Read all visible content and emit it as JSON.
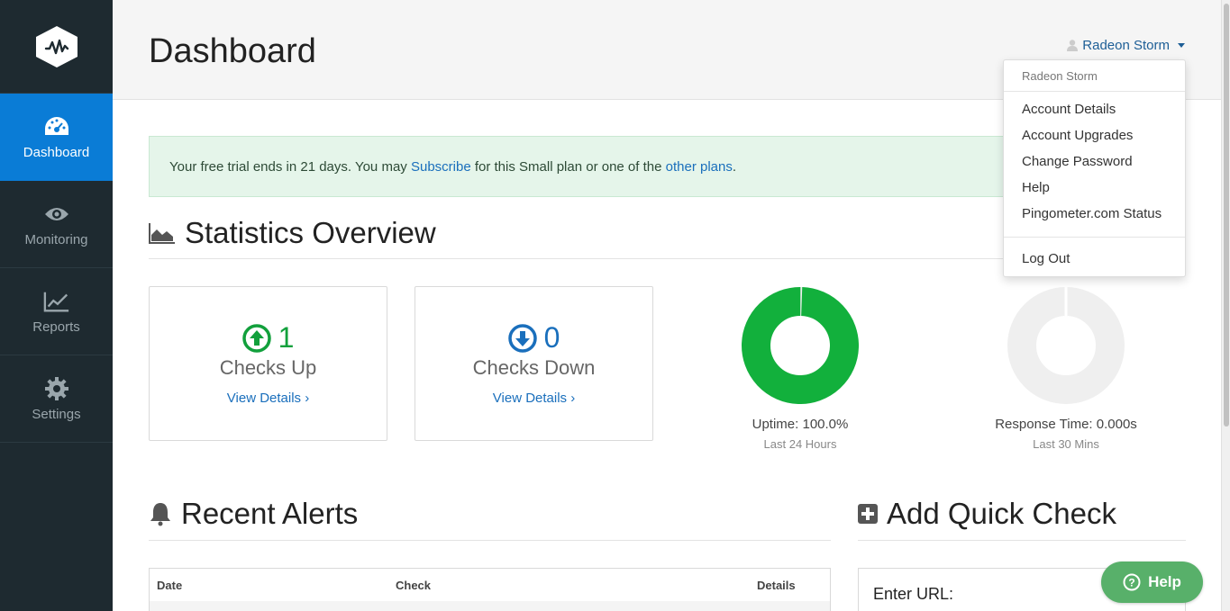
{
  "sidebar": {
    "items": [
      {
        "label": "Dashboard",
        "icon": "dashboard-gauge-icon",
        "active": true
      },
      {
        "label": "Monitoring",
        "icon": "eye-icon",
        "active": false
      },
      {
        "label": "Reports",
        "icon": "line-chart-icon",
        "active": false
      },
      {
        "label": "Settings",
        "icon": "gear-icon",
        "active": false
      }
    ]
  },
  "header": {
    "title": "Dashboard",
    "user_name": "Radeon Storm"
  },
  "trial_notice": {
    "prefix": "Your free trial ends in 21 days. You may ",
    "subscribe_link": "Subscribe",
    "middle": " for this Small plan or one of the ",
    "plans_link": "other plans",
    "suffix": "."
  },
  "statistics": {
    "title": "Statistics Overview",
    "checks_up": {
      "value": "1",
      "label": "Checks Up",
      "link": "View Details ›"
    },
    "checks_down": {
      "value": "0",
      "label": "Checks Down",
      "link": "View Details ›"
    },
    "uptime": {
      "label": "Uptime: 100.0%",
      "sub": "Last 24 Hours",
      "fraction": 1.0
    },
    "response": {
      "label": "Response Time: 0.000s",
      "sub": "Last 30 Mins",
      "fraction": 0.0
    }
  },
  "recent_alerts": {
    "title": "Recent Alerts",
    "columns": [
      "Date",
      "Check",
      "Details"
    ]
  },
  "quick_check": {
    "title": "Add Quick Check",
    "url_label": "Enter URL:"
  },
  "help_button": {
    "label": "Help"
  },
  "user_dropdown": {
    "header": "Radeon Storm",
    "items": [
      "Account Details",
      "Account Upgrades",
      "Change Password",
      "Help",
      "Pingometer.com Status"
    ],
    "logout": "Log Out"
  },
  "colors": {
    "sidebar_bg": "#1e2a30",
    "accent_blue": "#0a7cd6",
    "green": "#12b03c",
    "link": "#1a6fbc"
  }
}
